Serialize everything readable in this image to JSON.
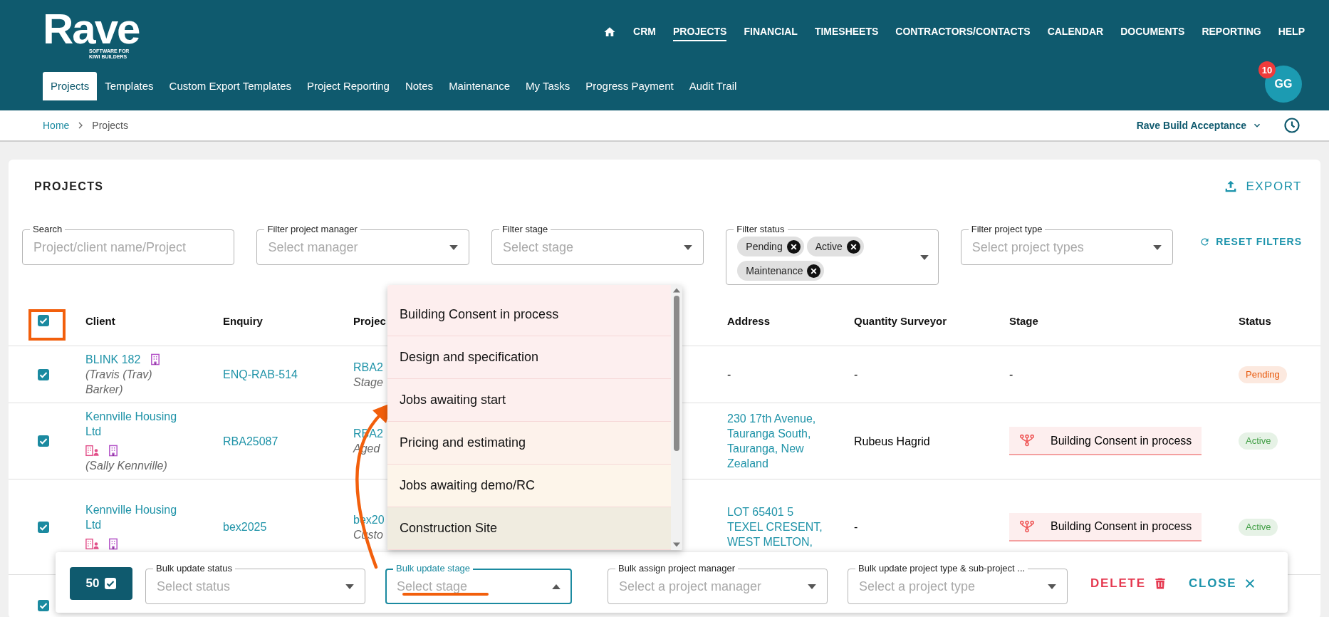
{
  "header": {
    "logo": "Rave",
    "tagline": [
      "SOFTWARE FOR",
      "KIWI BUILDERS"
    ],
    "nav": [
      {
        "label": "CRM",
        "selected": false
      },
      {
        "label": "PROJECTS",
        "selected": true
      },
      {
        "label": "FINANCIAL",
        "selected": false
      },
      {
        "label": "TIMESHEETS",
        "selected": false
      },
      {
        "label": "CONTRACTORS/CONTACTS",
        "selected": false
      },
      {
        "label": "CALENDAR",
        "selected": false
      },
      {
        "label": "DOCUMENTS",
        "selected": false
      },
      {
        "label": "REPORTING",
        "selected": false
      },
      {
        "label": "HELP",
        "selected": false
      }
    ],
    "tabs": [
      {
        "label": "Projects",
        "selected": true
      },
      {
        "label": "Templates",
        "selected": false
      },
      {
        "label": "Custom Export Templates",
        "selected": false
      },
      {
        "label": "Project Reporting",
        "selected": false
      },
      {
        "label": "Notes",
        "selected": false
      },
      {
        "label": "Maintenance",
        "selected": false
      },
      {
        "label": "My Tasks",
        "selected": false
      },
      {
        "label": "Progress Payment",
        "selected": false
      },
      {
        "label": "Audit Trail",
        "selected": false
      }
    ],
    "avatar": {
      "initials": "GG",
      "badge": "10"
    }
  },
  "breadcrumb": {
    "items": [
      "Home",
      "Projects"
    ],
    "company": "Rave Build Acceptance"
  },
  "panel": {
    "title": "PROJECTS",
    "export": "EXPORT",
    "reset": "RESET FILTERS",
    "filters": [
      {
        "kind": "text",
        "label": "Search",
        "placeholder": "Project/client name/Project"
      },
      {
        "kind": "select",
        "label": "Filter project manager",
        "placeholder": "Select manager"
      },
      {
        "kind": "select",
        "label": "Filter stage",
        "placeholder": "Select stage"
      },
      {
        "kind": "chips",
        "label": "Filter status",
        "chips": [
          "Pending",
          "Active",
          "Maintenance"
        ]
      },
      {
        "kind": "select",
        "label": "Filter project type",
        "placeholder": "Select project types"
      }
    ]
  },
  "table": {
    "select_all": {
      "checked": true
    },
    "columns": {
      "client": "Client",
      "enquiry": "Enquiry",
      "project": "Projec",
      "address": "Address",
      "quantity_surveyor": "Quantity Surveyor",
      "stage": "Stage",
      "status": "Status"
    },
    "rows": [
      {
        "checked": true,
        "client": {
          "name": "BLINK 182",
          "contact_linked": false,
          "contact": "(Travis (Trav) Barker)"
        },
        "enquiry": "ENQ-RAB-514",
        "project": {
          "code": "RBA2",
          "note": "Stage"
        },
        "address": "-",
        "quantity_surveyor": "-",
        "stage": {
          "kind": "plain",
          "label": "-"
        },
        "status": {
          "label": "Pending",
          "color": "#e8590c"
        }
      },
      {
        "checked": true,
        "client": {
          "name": "Kennville Housing Ltd",
          "contact_linked": true,
          "contact": "(Sally Kennville)"
        },
        "enquiry": "RBA25087",
        "project": {
          "code": "RBA2",
          "note": "Aged"
        },
        "address": "230 17th Avenue, Tauranga South, Tauranga, New Zealand",
        "quantity_surveyor": "Rubeus Hagrid",
        "stage": {
          "kind": "chip",
          "label": "Building Consent in process"
        },
        "status": {
          "label": "Active",
          "color": "#43a047"
        }
      },
      {
        "checked": true,
        "client": {
          "name": "Kennville Housing Ltd",
          "contact_linked": true
        },
        "enquiry": "bex2025",
        "project": {
          "code": "bex20",
          "note": "Custo"
        },
        "address": "LOT 65401 5 TEXEL CRESENT, WEST MELTON,",
        "quantity_surveyor": "-",
        "stage": {
          "kind": "chip",
          "label": "Building Consent in process"
        },
        "status": {
          "label": "Active",
          "color": "#43a047"
        }
      },
      {
        "checked": true
      }
    ]
  },
  "stage_dropdown": {
    "options": [
      {
        "label": "Building Consent in process",
        "color": "#fdeeee"
      },
      {
        "label": "Design and specification",
        "color": "#fdefef"
      },
      {
        "label": "Jobs awaiting start",
        "color": "#fdefee"
      },
      {
        "label": "Pricing and estimating",
        "color": "#fdf2eb"
      },
      {
        "label": "Jobs awaiting demo/RC",
        "color": "#fdf5ea"
      },
      {
        "label": "Construction Site",
        "color": "#f0ece0"
      }
    ]
  },
  "bulk_bar": {
    "count": "50",
    "fields": [
      {
        "label": "Bulk update status",
        "placeholder": "Select status",
        "open": false
      },
      {
        "label": "Bulk update stage",
        "placeholder": "Select stage",
        "open": true
      },
      {
        "label": "Bulk assign project manager",
        "placeholder": "Select a project manager",
        "open": false
      },
      {
        "label": "Bulk update project type & sub-project ...",
        "placeholder": "Select a project type",
        "open": false
      }
    ],
    "delete": "DELETE",
    "close": "CLOSE"
  }
}
